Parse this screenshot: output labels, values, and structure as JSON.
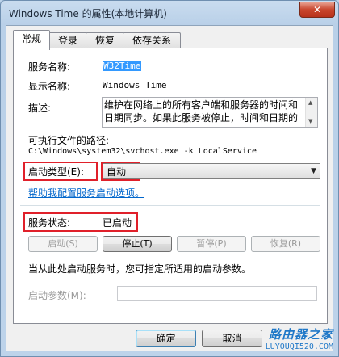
{
  "window": {
    "title": "Windows Time 的属性(本地计算机)",
    "close_glyph": "✕"
  },
  "tabs": [
    {
      "label": "常规",
      "active": true
    },
    {
      "label": "登录",
      "active": false
    },
    {
      "label": "恢复",
      "active": false
    },
    {
      "label": "依存关系",
      "active": false
    }
  ],
  "general": {
    "service_name_label": "服务名称:",
    "service_name_value": "W32Time",
    "display_name_label": "显示名称:",
    "display_name_value": "Windows Time",
    "description_label": "描述:",
    "description_value": "维护在网络上的所有客户端和服务器的时间和日期同步。如果此服务被停止，时间和日期的",
    "exe_path_label": "可执行文件的路径:",
    "exe_path_value": "C:\\Windows\\system32\\svchost.exe -k LocalService",
    "startup_type_label": "启动类型(E):",
    "startup_type_value": "自动",
    "help_link": "帮助我配置服务启动选项。",
    "status_label": "服务状态:",
    "status_value": "已启动",
    "buttons": {
      "start": "启动(S)",
      "stop": "停止(T)",
      "pause": "暂停(P)",
      "resume": "恢复(R)"
    },
    "hint": "当从此处启动服务时，您可指定所适用的启动参数。",
    "start_params_label": "启动参数(M):",
    "start_params_value": ""
  },
  "footer": {
    "ok": "确定",
    "cancel": "取消"
  },
  "watermark": {
    "cn": "路由器之家",
    "url": "LUYOUQI520.COM"
  },
  "colors": {
    "highlight_box": "#e0202a",
    "link": "#0066cc",
    "selection": "#3399ff"
  }
}
